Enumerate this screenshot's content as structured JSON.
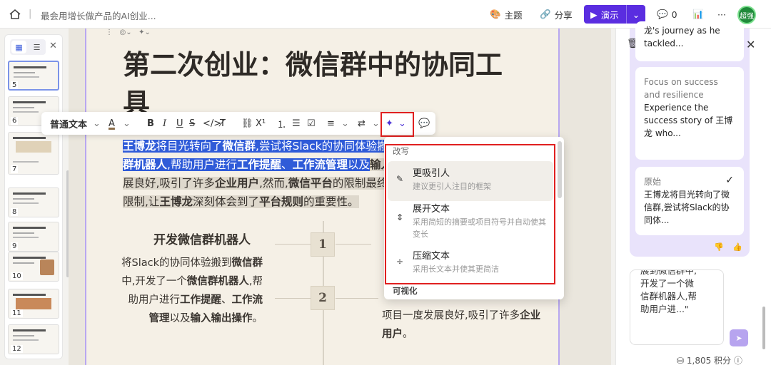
{
  "topbar": {
    "doc_title": "最会用增长做产品的AI创业...",
    "theme_label": "主题",
    "share_label": "分享",
    "present_label": "演示",
    "comment_count": "0",
    "avatar_text": "超强"
  },
  "thumbnails": [
    {
      "num": "5",
      "selected": true
    },
    {
      "num": "6"
    },
    {
      "num": "7"
    },
    {
      "num": "8"
    },
    {
      "num": "9"
    },
    {
      "num": "10"
    },
    {
      "num": "11"
    },
    {
      "num": "12"
    }
  ],
  "slide": {
    "title": "第二次创业：微信群中的协同工具",
    "para_parts": {
      "p1a": "王博龙",
      "p1b": "将目光转向了",
      "p1c": "微信群",
      "p1d": ",尝试将Slack的协同体验搬到",
      "p2a": "群机器人",
      "p2b": ",帮助用户进行",
      "p2c": "工作提醒",
      "p2d": "、",
      "p2e": "工作流管理",
      "p2f": "以及",
      "p2g": "输入",
      "p3a": "展良好,吸引了许多",
      "p3b": "企业用户",
      "p3c": ",然而,",
      "p3d": "微信平台",
      "p3e": "的限制最终",
      "p4a": "限制,让",
      "p4b": "王博龙",
      "p4c": "深刻体会到了",
      "p4d": "平台规则",
      "p4e": "的重要性。"
    },
    "timeline": {
      "node1": "1",
      "node2": "2",
      "sec1_title": "开发微信群机器人",
      "sec1_parts": {
        "a": "将Slack的协同体验搬到",
        "b": "微信群",
        "c": "中,开发了一个",
        "d": "微信群机器人",
        "e": ",帮助用户进行",
        "f": "工作提醒",
        "g": "、",
        "h": "工作流管理",
        "i": "以及",
        "j": "输入输出操作",
        "k": "。"
      },
      "sec2_parts": {
        "a": "项目一度发展良好,吸引了许多",
        "b": "企业用户",
        "c": "。"
      }
    }
  },
  "format_toolbar": {
    "style_select": "普通文本",
    "font_color_label": "A"
  },
  "ai_menu": {
    "section_rewrite": "改写",
    "items": [
      {
        "title": "更吸引人",
        "desc": "建议更引人注目的框架",
        "icon": "pencil-icon"
      },
      {
        "title": "展开文本",
        "desc": "采用简短的摘要或项目符号并自动使其变长",
        "icon": "expand-icon"
      },
      {
        "title": "压缩文本",
        "desc": "采用长文本并使其更简洁",
        "icon": "compress-icon"
      }
    ],
    "section_visualize": "可视化"
  },
  "right_panel": {
    "card1": "龙's journey as he tackled...",
    "card2_muted": "Focus on success and resilience",
    "card2_text": "Experience the success story of 王博龙 who...",
    "card3_label": "原始",
    "card3_text": "王博龙将目光转向了微信群,尝试将Slack的协同体...",
    "input_text": "展到微信群中,开发了一个微信群机器人,帮助用户进...\"",
    "credits": "1,805 积分"
  }
}
